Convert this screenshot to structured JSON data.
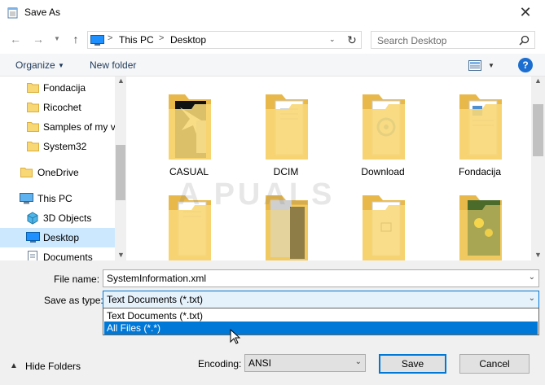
{
  "window": {
    "title": "Save As",
    "close_glyph": "✕"
  },
  "nav": {
    "back_glyph": "←",
    "forward_glyph": "→",
    "up_glyph": "↑",
    "address": {
      "segments": [
        "This PC",
        "Desktop"
      ],
      "separator": ">"
    },
    "search_placeholder": "Search Desktop"
  },
  "toolbar": {
    "organize": "Organize",
    "new_folder": "New folder",
    "help": "?"
  },
  "navpane": {
    "items": [
      {
        "label": "Fondacija",
        "icon": "folder-icon"
      },
      {
        "label": "Ricochet",
        "icon": "folder-icon"
      },
      {
        "label": "Samples of my v",
        "icon": "folder-icon"
      },
      {
        "label": "System32",
        "icon": "folder-icon"
      },
      {
        "label": "OneDrive",
        "icon": "folder-icon"
      },
      {
        "label": "This PC",
        "icon": "computer-icon"
      },
      {
        "label": "3D Objects",
        "icon": "cube-icon"
      },
      {
        "label": "Desktop",
        "icon": "desktop-icon",
        "selected": true
      },
      {
        "label": "Documents",
        "icon": "documents-icon"
      }
    ]
  },
  "files": [
    {
      "name": "CASUAL"
    },
    {
      "name": "DCIM"
    },
    {
      "name": "Download"
    },
    {
      "name": "Fondacija"
    },
    {
      "name": ""
    },
    {
      "name": ""
    },
    {
      "name": ""
    },
    {
      "name": ""
    }
  ],
  "watermark": "A PUALS",
  "form": {
    "filename_label": "File name:",
    "filename_value": "SystemInformation.xml",
    "savetype_label": "Save as type:",
    "savetype_value": "Text Documents (*.txt)",
    "savetype_options": [
      "Text Documents (*.txt)",
      "All Files  (*.*)"
    ],
    "hide_folders": "Hide Folders",
    "encoding_label": "Encoding:",
    "encoding_value": "ANSI",
    "save": "Save",
    "cancel": "Cancel"
  },
  "colors": {
    "accent": "#0078d7",
    "selection": "#cce8ff",
    "folder": "#f8d775",
    "folder_dark": "#e8b84a"
  }
}
